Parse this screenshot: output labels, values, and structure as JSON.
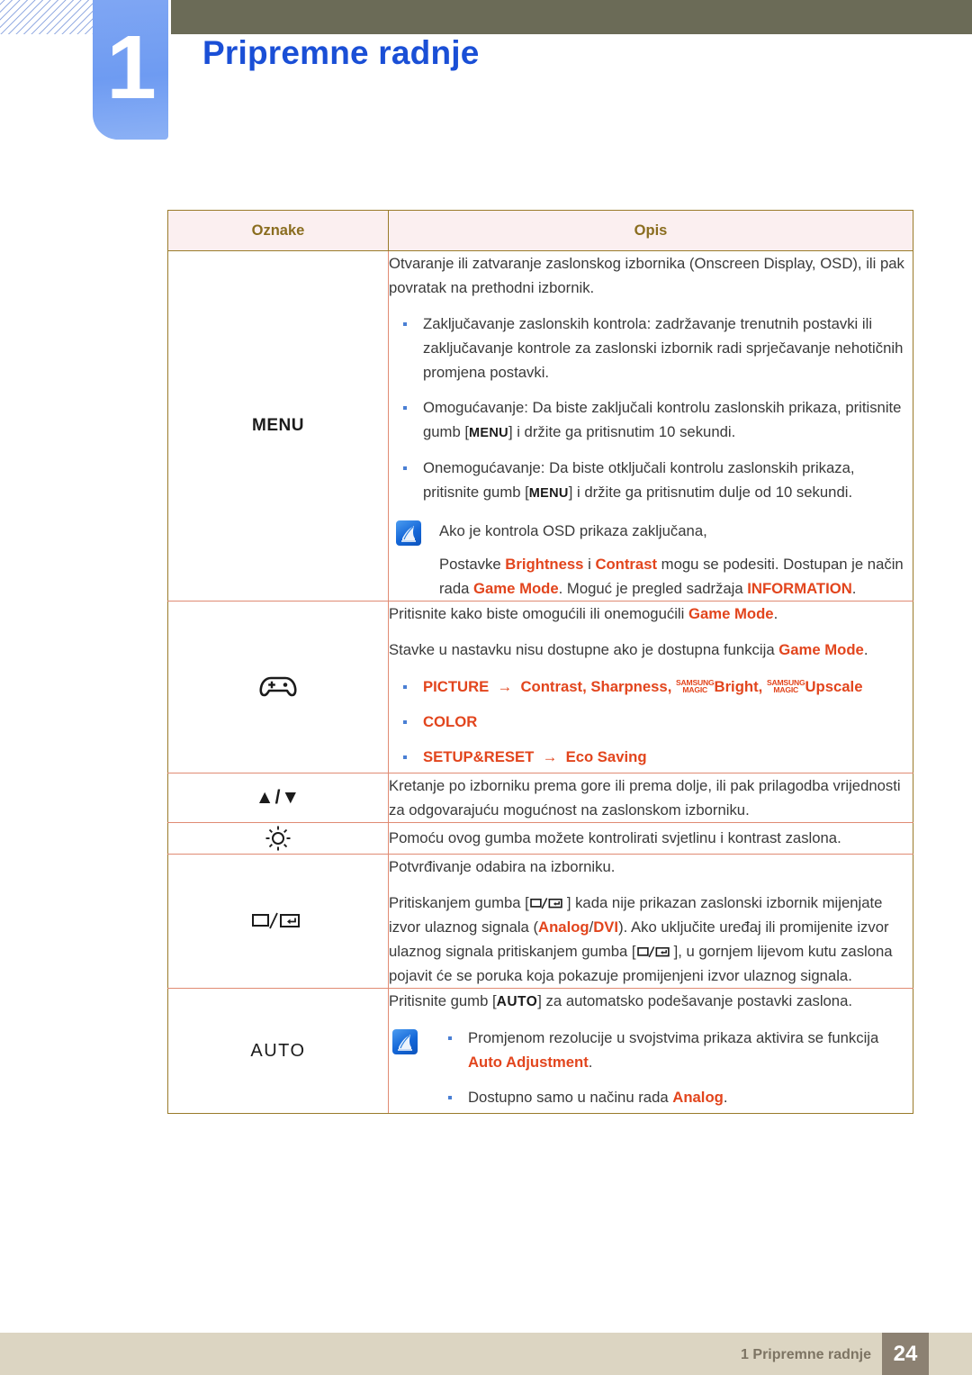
{
  "header": {
    "chapter_number": "1",
    "chapter_title": "Pripremne radnje"
  },
  "table": {
    "columns": [
      "Oznake",
      "Opis"
    ],
    "rows": [
      {
        "key_label": "MENU",
        "key_icon": "menu-text",
        "paragraphs": [
          "Otvaranje ili zatvaranje zaslonskog izbornika (Onscreen Display, OSD), ili pak povratak na prethodni izbornik."
        ],
        "bullets": [
          "Zaključavanje zaslonskih kontrola: zadržavanje trenutnih postavki ili zaključavanje kontrole za zaslonski izbornik radi sprječavanje nehotičnih promjena postavki.",
          "Omogućavanje: Da biste zaključali kontrolu zaslonskih prikaza, pritisnite gumb [MENU] i držite ga pritisnutim 10 sekundi.",
          "Onemogućavanje: Da biste otključali kontrolu zaslonskih prikaza, pritisnite gumb [MENU] i držite ga pritisnutim dulje od 10 sekundi."
        ],
        "note": {
          "line1": "Ako je kontrola OSD prikaza zaključana,",
          "line2_prefix": "Postavke ",
          "brightness": "Brightness",
          "and": " i ",
          "contrast": "Contrast",
          "line2_mid": " mogu se podesiti. Dostupan je način rada ",
          "game_mode": "Game Mode",
          "line2_mid2": ". Moguć je pregled sadržaja ",
          "information": "INFORMATION",
          "line2_end": "."
        }
      },
      {
        "key_label": "",
        "key_icon": "gamepad-icon",
        "line1_prefix": "Pritisnite kako biste omogućili ili onemogućili ",
        "line1_term": "Game Mode",
        "line1_end": ".",
        "line2_prefix": "Stavke u nastavku nisu dostupne ako je dostupna funkcija ",
        "line2_term": "Game Mode",
        "line2_end": ".",
        "menu_items": [
          {
            "main": "PICTURE",
            "arrow": "→",
            "rest_1": "Contrast",
            "comma_1": ", ",
            "rest_2": "Sharpness",
            "comma_2": ", ",
            "magic_top": "SAMSUNG",
            "magic_bottom": "MAGIC",
            "magic_word_1": "Bright",
            "comma_3": ", ",
            "magic_word_2": "Upscale"
          },
          {
            "main": "COLOR"
          },
          {
            "main": "SETUP&RESET",
            "arrow": "→",
            "rest_1": "Eco Saving"
          }
        ]
      },
      {
        "key_label": "▲/▼",
        "key_icon": "up-down-arrows-icon",
        "paragraphs": [
          "Kretanje po izborniku prema gore ili prema dolje, ili pak prilagodba vrijednosti za odgovarajuću mogućnost na zaslonskom izborniku."
        ]
      },
      {
        "key_label": "",
        "key_icon": "brightness-sun-icon",
        "paragraphs": [
          "Pomoću ovog gumba možete kontrolirati svjetlinu i kontrast zaslona."
        ]
      },
      {
        "key_label": "",
        "key_icon": "source-enter-icon",
        "paragraphs": [
          "Potvrđivanje odabira na izborniku."
        ],
        "long": {
          "p1": "Pritiskanjem gumba [",
          "p2": "] kada nije prikazan zaslonski izbornik mijenjate izvor ulaznog signala (",
          "analog": "Analog",
          "slash": "/",
          "dvi": "DVI",
          "p3": "). Ako uključite uređaj ili promijenite izvor ulaznog signala pritiskanjem gumba [",
          "p4": "], u gornjem lijevom kutu zaslona pojavit će se poruka koja pokazuje promijenjeni izvor ulaznog signala."
        }
      },
      {
        "key_label": "AUTO",
        "key_icon": "auto-text",
        "intro_prefix": "Pritisnite gumb [",
        "intro_kbd": "AUTO",
        "intro_suffix": "] za automatsko podešavanje postavki zaslona.",
        "note_bullets": [
          {
            "text_prefix": "Promjenom rezolucije u svojstvima prikaza aktivira se funkcija ",
            "term": "Auto Adjustment",
            "text_end": "."
          },
          {
            "text_prefix": "Dostupno samo u načinu rada ",
            "term": "Analog",
            "text_end": "."
          }
        ]
      }
    ]
  },
  "footer": {
    "label": "1 Pripremne radnje",
    "page": "24"
  },
  "colors": {
    "chapter_title": "#1a4fd6",
    "top_bar": "#6b6b57",
    "table_border": "#e08b73",
    "table_outer_border": "#9a7b2a",
    "header_bg": "#fbeff0",
    "header_text": "#8a6d1f",
    "accent_orange": "#e2451d",
    "bullet_blue": "#4a7fd4",
    "footer_bg": "#dcd5c2",
    "page_box_bg": "#8c8172"
  }
}
